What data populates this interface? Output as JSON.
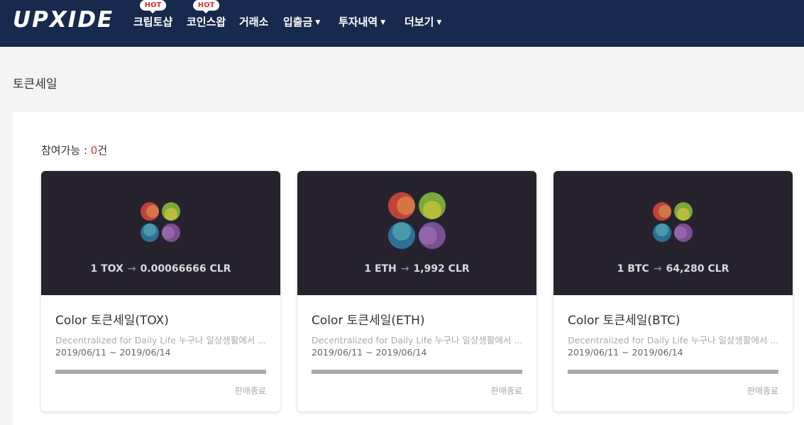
{
  "header": {
    "logo": "UPXIDE",
    "nav": [
      {
        "label": "크립토샵",
        "badge": "HOT",
        "dropdown": false
      },
      {
        "label": "코인스왑",
        "badge": "HOT",
        "dropdown": false
      },
      {
        "label": "거래소",
        "badge": "",
        "dropdown": false
      },
      {
        "label": "입출금",
        "badge": "",
        "dropdown": true
      },
      {
        "label": "투자내역",
        "badge": "",
        "dropdown": true
      },
      {
        "label": "더보기",
        "badge": "",
        "dropdown": true
      }
    ],
    "dropdown_caret": "▼"
  },
  "page": {
    "title": "토큰세일",
    "count_label": "참여가능 : ",
    "count_value": "0",
    "count_unit": "건"
  },
  "cards": [
    {
      "title": "Color 토큰세일(TOX)",
      "rate_from": "1 TOX",
      "rate_arrow": "→",
      "rate_to": "0.00066666 CLR",
      "description": "Decentralized for Daily Life 누구나 일상생활에서 ...",
      "dates": "2019/06/11 ~ 2019/06/14",
      "progress": 1.0,
      "status": "판매종료",
      "logo_icon": "color-quad-circle-icon",
      "logo_scale": "small"
    },
    {
      "title": "Color 토큰세일(ETH)",
      "rate_from": "1 ETH",
      "rate_arrow": "→",
      "rate_to": "1,992 CLR",
      "description": "Decentralized for Daily Life 누구나 일상생활에서 ...",
      "dates": "2019/06/11 ~ 2019/06/14",
      "progress": 1.0,
      "status": "판매종료",
      "logo_icon": "color-quad-circle-icon",
      "logo_scale": "large"
    },
    {
      "title": "Color 토큰세일(BTC)",
      "rate_from": "1 BTC",
      "rate_arrow": "→",
      "rate_to": "64,280 CLR",
      "description": "Decentralized for Daily Life 누구나 일상생활에서 ...",
      "dates": "2019/06/11 ~ 2019/06/14",
      "progress": 1.0,
      "status": "판매종료",
      "logo_icon": "color-quad-circle-icon",
      "logo_scale": "small"
    }
  ],
  "colors": {
    "header_bg": "#172a4e",
    "accent_red": "#e03131",
    "card_top_bg": "#26232f",
    "progress_fill": "#aaaaaa",
    "logo_red": "#c0433a",
    "logo_orange": "#d9854a",
    "logo_green": "#7aa83a",
    "logo_yellow": "#c5c23e",
    "logo_blue": "#2d6f97",
    "logo_teal": "#4fa1ad",
    "logo_purple": "#7a4f93",
    "logo_violet": "#9a6ab0"
  }
}
